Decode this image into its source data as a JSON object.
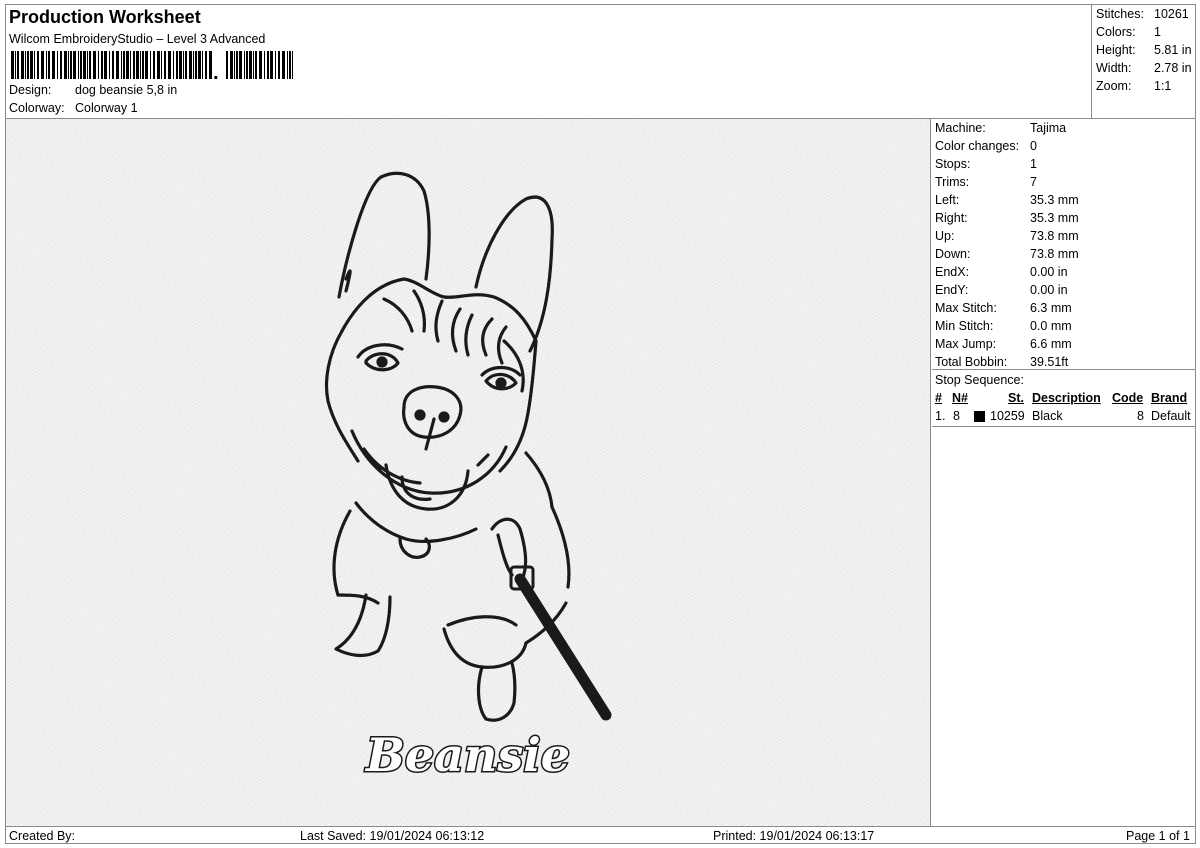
{
  "header": {
    "title": "Production Worksheet",
    "software": "Wilcom EmbroideryStudio – Level 3 Advanced",
    "design_label": "Design:",
    "design_value": "dog beansie 5,8 in",
    "colorway_label": "Colorway:",
    "colorway_value": "Colorway 1"
  },
  "summary": {
    "stitches_label": "Stitches:",
    "stitches": "10261",
    "colors_label": "Colors:",
    "colors": "1",
    "height_label": "Height:",
    "height": "5.81 in",
    "width_label": "Width:",
    "width": "2.78 in",
    "zoom_label": "Zoom:",
    "zoom": "1:1"
  },
  "details": [
    {
      "label": "Machine:",
      "value": "Tajima"
    },
    {
      "label": "Color changes:",
      "value": "0"
    },
    {
      "label": "Stops:",
      "value": "1"
    },
    {
      "label": "Trims:",
      "value": "7"
    },
    {
      "label": "Left:",
      "value": "35.3 mm"
    },
    {
      "label": "Right:",
      "value": "35.3 mm"
    },
    {
      "label": "Up:",
      "value": "73.8 mm"
    },
    {
      "label": "Down:",
      "value": "73.8 mm"
    },
    {
      "label": "EndX:",
      "value": "0.00 in"
    },
    {
      "label": "EndY:",
      "value": "0.00 in"
    },
    {
      "label": "Max Stitch:",
      "value": "6.3 mm"
    },
    {
      "label": "Min Stitch:",
      "value": "0.0 mm"
    },
    {
      "label": "Max Jump:",
      "value": "6.6 mm"
    },
    {
      "label": "Total Bobbin:",
      "value": "39.51ft"
    }
  ],
  "stop_sequence": {
    "title": "Stop Sequence:",
    "columns": {
      "index": "#",
      "needle": "N#",
      "stitches": "St.",
      "description": "Description",
      "code": "Code",
      "brand": "Brand"
    },
    "rows": [
      {
        "index": "1.",
        "needle": "8",
        "color": "#000000",
        "stitches": "10259",
        "description": "Black",
        "code": "8",
        "brand": "Default"
      }
    ]
  },
  "design_preview": {
    "name_text": "Beansie",
    "thread_color": "#1a1a1a"
  },
  "footer": {
    "created_by": "Created By:",
    "last_saved": "Last Saved: 19/01/2024 06:13:12",
    "printed": "Printed: 19/01/2024 06:13:17",
    "page": "Page 1 of 1"
  }
}
